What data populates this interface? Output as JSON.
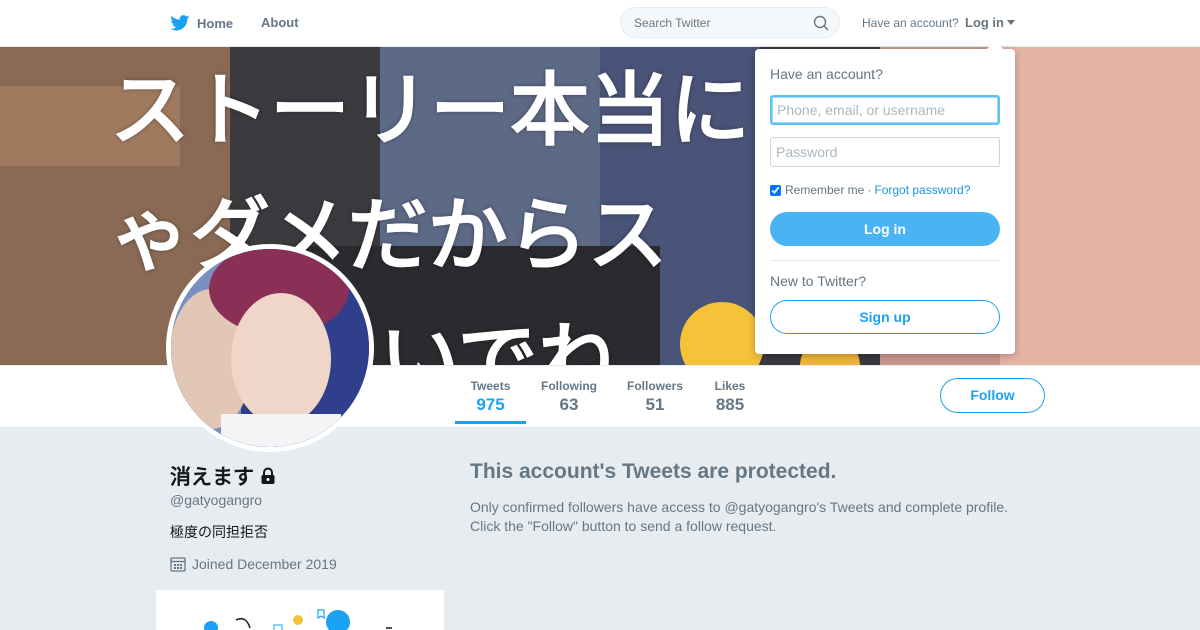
{
  "topbar": {
    "home_label": "Home",
    "about_label": "About",
    "search_placeholder": "Search Twitter",
    "have_account": "Have an account?",
    "login_label": "Log in"
  },
  "banner": {
    "line1": "ストーリー本当に",
    "line2": "ゃダメだからス",
    "line3": "いでね"
  },
  "stats": [
    {
      "label": "Tweets",
      "value": "975"
    },
    {
      "label": "Following",
      "value": "63"
    },
    {
      "label": "Followers",
      "value": "51"
    },
    {
      "label": "Likes",
      "value": "885"
    }
  ],
  "follow_label": "Follow",
  "profile": {
    "name": "消えます",
    "handle": "@gatyogangro",
    "bio": "極度の同担拒否",
    "joined": "Joined December 2019"
  },
  "protected": {
    "title": "This account's Tweets are protected.",
    "text": "Only confirmed followers have access to @gatyogangro's Tweets and complete profile. Click the \"Follow\" button to send a follow request."
  },
  "login_dropdown": {
    "heading": "Have an account?",
    "username_placeholder": "Phone, email, or username",
    "password_placeholder": "Password",
    "remember_label": "Remember me",
    "separator": "·",
    "forgot_label": "Forgot password?",
    "login_button": "Log in",
    "new_label": "New to Twitter?",
    "signup_button": "Sign up"
  },
  "colors": {
    "accent": "#1da1f2",
    "background": "#e6ecf0",
    "muted": "#657786"
  }
}
